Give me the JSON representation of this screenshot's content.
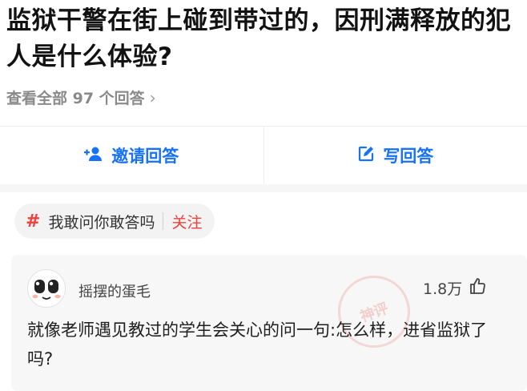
{
  "question": {
    "title": "监狱干警在街上碰到带过的，因刑满释放的犯人是什么体验?"
  },
  "view_all": {
    "label": "查看全部 97 个回答",
    "chevron": "›"
  },
  "actions": {
    "invite_label": "邀请回答",
    "write_label": "写回答",
    "invite_icon": "add-user-icon",
    "write_icon": "edit-icon",
    "accent_color": "#1772f6"
  },
  "topic": {
    "hash": "#",
    "label": "我敢问你敢答吗",
    "follow_label": "关注",
    "accent_color": "#f1403c"
  },
  "answer": {
    "author": "摇摆的蛋毛",
    "likes": "1.8万",
    "stamp_text": "神评",
    "text": "就像老师遇见教过的学生会关心的问一句:怎么样，进省监狱了吗?"
  }
}
